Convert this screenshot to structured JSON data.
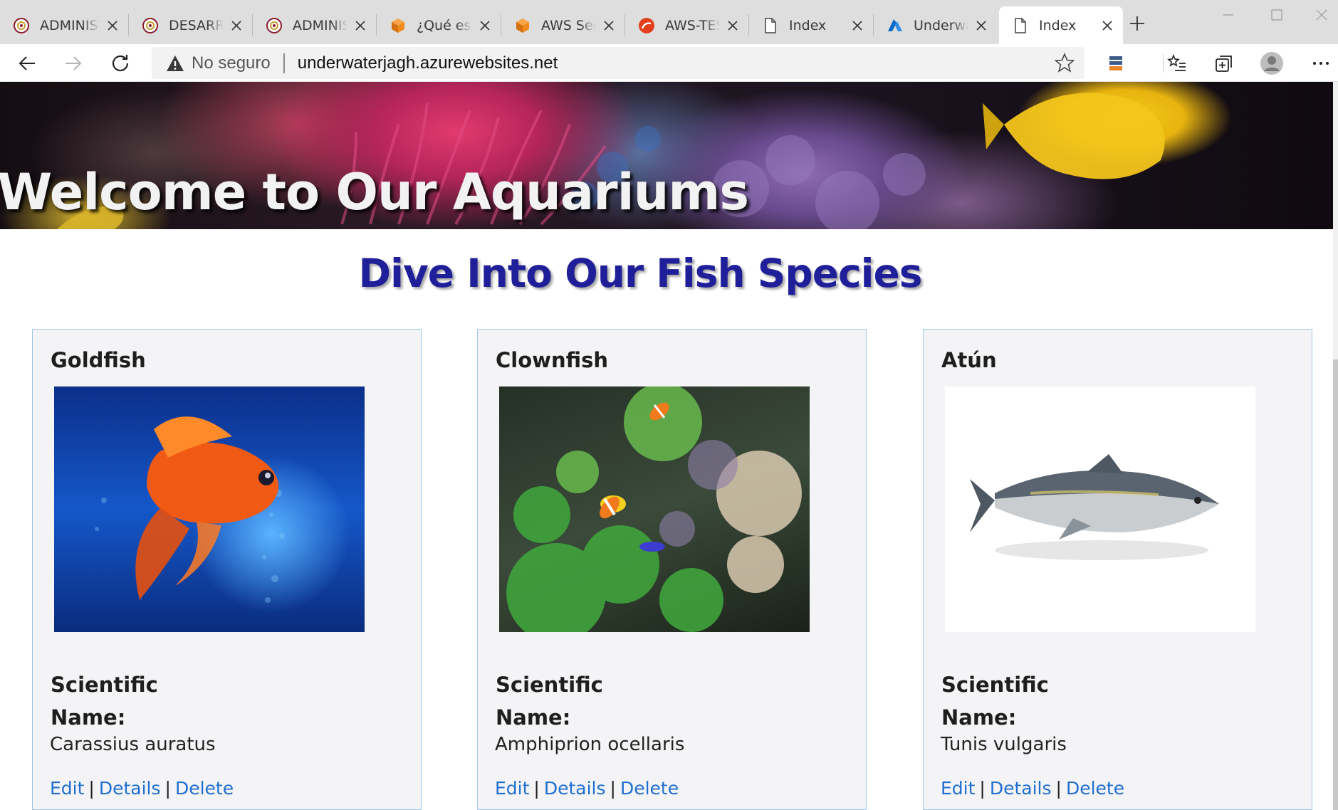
{
  "browser": {
    "tabs": [
      {
        "title": "ADMINISTRACIÓN",
        "favicon": "university-seal-icon",
        "active": false
      },
      {
        "title": "DESARROLLO",
        "favicon": "university-seal-icon",
        "active": false
      },
      {
        "title": "ADMINISTRACIÓN",
        "favicon": "university-seal-icon",
        "active": false
      },
      {
        "title": "¿Qué es DynamoDB",
        "favicon": "aws-orange-cube-icon",
        "active": false
      },
      {
        "title": "AWS Security",
        "favicon": "aws-orange-cube-icon",
        "active": false
      },
      {
        "title": "AWS-TEST",
        "favicon": "red-swirl-icon",
        "active": false
      },
      {
        "title": "Index",
        "favicon": "page-icon",
        "active": false
      },
      {
        "title": "Underwater",
        "favicon": "azure-icon",
        "active": false
      },
      {
        "title": "Index",
        "favicon": "page-icon",
        "active": true
      }
    ],
    "security_label": "No seguro",
    "url": "underwaterjagh.azurewebsites.net",
    "colors": {
      "tabstrip": "#dedede",
      "omnibox": "#f2f2f2"
    }
  },
  "page": {
    "hero_title": "Welcome to Our Aquariums",
    "section_title": "Dive Into Our Fish Species",
    "scientific_label": "Scientific Name:",
    "actions": {
      "edit": "Edit",
      "details": "Details",
      "delete": "Delete"
    },
    "fish": [
      {
        "name": "Goldfish",
        "scientific_name": "Carassius auratus",
        "image": "goldfish-photo"
      },
      {
        "name": "Clownfish",
        "scientific_name": "Amphiprion ocellaris",
        "image": "clownfish-reef-photo"
      },
      {
        "name": "Atún",
        "scientific_name": "Tunis vulgaris",
        "image": "tuna-photo"
      }
    ],
    "colors": {
      "section_title": "#1f1f9a",
      "link": "#1f6fd1",
      "card_border": "#9fc8e6",
      "card_bg": "#f4f4f6"
    }
  }
}
